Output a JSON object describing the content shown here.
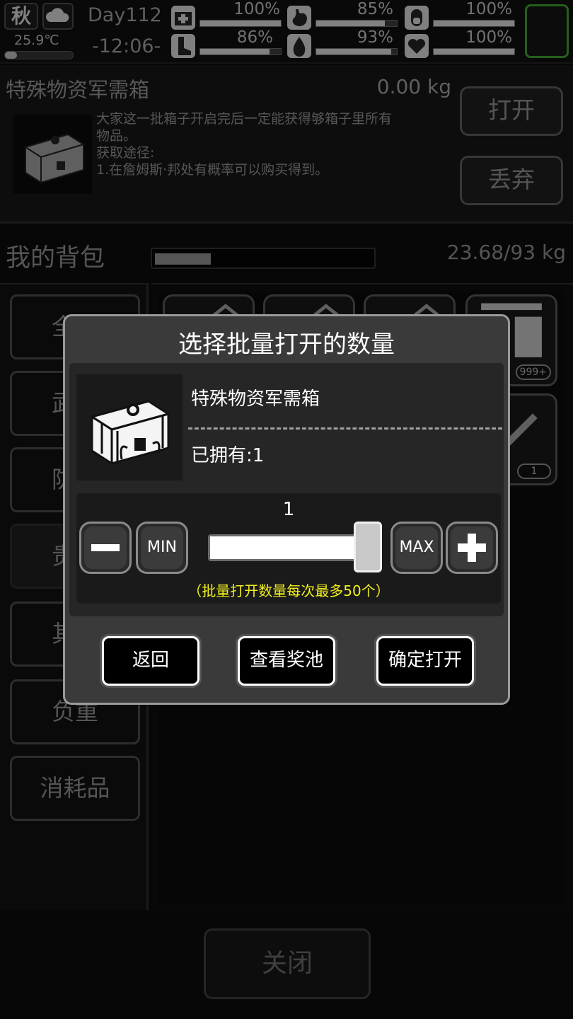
{
  "status": {
    "season": "秋",
    "temperature": "25.9℃",
    "temperature_level": 0.18,
    "day": "Day112",
    "time": "-12:06-",
    "stats": [
      {
        "icon": "medkit-icon",
        "pct": "100%",
        "level": 1.0
      },
      {
        "icon": "stomach-icon",
        "pct": "85%",
        "level": 0.85
      },
      {
        "icon": "pill-icon",
        "pct": "100%",
        "level": 1.0
      },
      {
        "icon": "foot-icon",
        "pct": "86%",
        "level": 0.86
      },
      {
        "icon": "water-drop-icon",
        "pct": "93%",
        "level": 0.93
      },
      {
        "icon": "heart-icon",
        "pct": "100%",
        "level": 1.0
      }
    ],
    "accent_color": "#3c9a2e"
  },
  "item_detail": {
    "name": "特殊物资军需箱",
    "weight": "0.00 kg",
    "description_lines": [
      "大家这一批箱子开启完后一定能获得够箱子里所有",
      "物品。",
      "获取途径:",
      "1.在詹姆斯·邦处有概率可以购买得到。"
    ],
    "open_label": "打开",
    "discard_label": "丢弃"
  },
  "bag": {
    "title": "我的背包",
    "weight": "23.68/93 kg",
    "fill_level": 0.255
  },
  "categories": [
    "全部",
    "武器",
    "防具",
    "贵重",
    "其他",
    "负重",
    "消耗品"
  ],
  "grid": {
    "counts": [
      "999+",
      "1"
    ]
  },
  "close_label": "关闭",
  "dialog": {
    "title": "选择批量打开的数量",
    "item_name": "特殊物资军需箱",
    "owned": "已拥有:1",
    "quantity": "1",
    "slider_level": 1.0,
    "min_label": "MIN",
    "max_label": "MAX",
    "note": "（批量打开数量每次最多50个）",
    "note_color": "#f0f020",
    "back_label": "返回",
    "pool_label": "查看奖池",
    "confirm_label": "确定打开"
  }
}
